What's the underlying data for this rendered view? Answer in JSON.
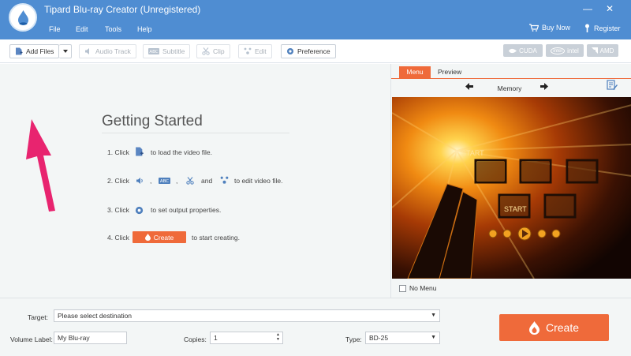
{
  "window": {
    "title": "Tipard Blu-ray Creator (Unregistered)",
    "minimize": "—",
    "close": "✕"
  },
  "menu": {
    "file": "File",
    "edit": "Edit",
    "tools": "Tools",
    "help": "Help",
    "buy_now": "Buy Now",
    "register": "Register"
  },
  "toolbar": {
    "add_files": "Add Files",
    "audio_track": "Audio Track",
    "subtitle": "Subtitle",
    "clip": "Clip",
    "edit": "Edit",
    "preference": "Preference",
    "hw_cuda": "CUDA",
    "hw_intel_badge": "intel",
    "hw_intel": "intel",
    "hw_amd": "AMD"
  },
  "getting_started": {
    "title": "Getting Started",
    "step1_prefix": "1. Click",
    "step1_suffix": "to load the video file.",
    "step2_prefix": "2. Click",
    "step2_comma1": ",",
    "step2_comma2": ",",
    "step2_and": "and",
    "step2_suffix": "to edit video file.",
    "step3_prefix": "3. Click",
    "step3_suffix": "to set output properties.",
    "step4_prefix": "4. Click",
    "step4_button": "Create",
    "step4_suffix": "to start creating."
  },
  "menu_panel": {
    "tab_menu": "Menu",
    "tab_preview": "Preview",
    "template_name": "Memory",
    "no_menu": "No Menu",
    "preview_text_1": "START",
    "preview_text_2": "START"
  },
  "output": {
    "target_label": "Target:",
    "target_value": "Please select destination",
    "volume_label": "Volume Label:",
    "volume_value": "My Blu-ray",
    "copies_label": "Copies:",
    "copies_value": "1",
    "type_label": "Type:",
    "type_value": "BD-25",
    "create_button": "Create"
  },
  "colors": {
    "titlebar": "#4f8dd2",
    "accent": "#ef6a3a",
    "arrow": "#e8246f"
  }
}
